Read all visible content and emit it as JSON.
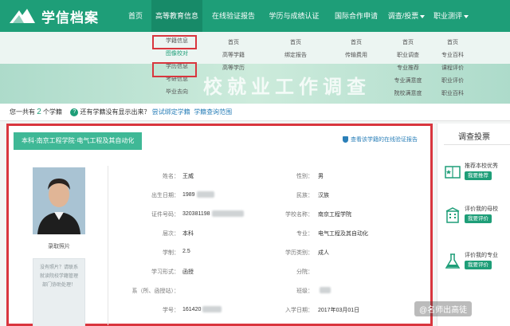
{
  "header": {
    "brand": "学信档案",
    "nav": [
      {
        "label": "首页"
      },
      {
        "label": "高等教育信息",
        "active": true
      },
      {
        "label": "在线验证报告"
      },
      {
        "label": "学历与成绩认证"
      },
      {
        "label": "国际合作申请"
      },
      {
        "label": "调查/投票"
      },
      {
        "label": "职业测评"
      }
    ]
  },
  "dropdown": {
    "main_items": [
      "学籍信息",
      "图像校对",
      "学历信息",
      "考研信息",
      "毕业去向"
    ],
    "col1": [
      "首页",
      "高等学籍",
      "高等学历"
    ],
    "col2": [
      "首页",
      "绑定报告"
    ],
    "col3": [
      "首页",
      "传输费用"
    ],
    "col4": [
      "首页",
      "职业调查",
      "专业推荐",
      "专业满意度",
      "院校满意度"
    ],
    "col5": [
      "首页",
      "专业百科",
      "课程评价",
      "职业评价",
      "职业百科"
    ],
    "banner": "校就业工作调查"
  },
  "account_bar": {
    "prefix": "您一共有",
    "count": "2",
    "suffix": "个学籍",
    "question": "还有学籍没有显示出来？",
    "bind_link": "尝试绑定学籍",
    "scope_link": "学籍查询范围"
  },
  "record": {
    "title": "本科·南京工程学院·电气工程及其自动化",
    "verify_link": "查看该学籍的在线验证报告",
    "photo_caption": "录取照片",
    "no_photo_text": "没有照片？请联系就读院校学籍管理部门协助处理！",
    "fields": {
      "name_label": "姓名：",
      "name": "王威",
      "gender_label": "性别：",
      "gender": "男",
      "birth_label": "出生日期：",
      "birth": "1989",
      "ethnic_label": "民族：",
      "ethnic": "汉族",
      "id_label": "证件号码：",
      "id": "320381198",
      "school_label": "学校名称：",
      "school": "南京工程学院",
      "level_label": "层次：",
      "level": "本科",
      "major_label": "专业：",
      "major": "电气工程及其自动化",
      "length_label": "学制：",
      "length": "2.5",
      "category_label": "学历类别：",
      "category": "成人",
      "form_label": "学习形式：",
      "form": "函授",
      "branch_label": "分院：",
      "branch": "",
      "dept_label": "系（所、函授站）：",
      "dept": "",
      "class_label": "班级：",
      "class": "",
      "sid_label": "学号：",
      "sid": "161420",
      "enroll_label": "入学日期：",
      "enroll": "2017年03月01日"
    }
  },
  "sidebar": {
    "title": "调查投票",
    "items": [
      {
        "text": "推荐本校优秀",
        "button": "我要推荐"
      },
      {
        "text": "评价我的母校",
        "button": "我要评价"
      },
      {
        "text": "评价我的专业",
        "button": "我要评价"
      }
    ]
  },
  "watermark": "@名师出高徒",
  "colors": {
    "brand": "#1e9e78",
    "highlight": "#d9363e"
  }
}
